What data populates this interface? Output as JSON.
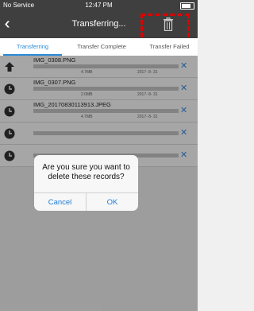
{
  "status_bar": {
    "carrier": "No Service",
    "wifi_icon": "wifi-icon",
    "time": "12:47 PM",
    "battery_icon": "battery-icon"
  },
  "nav": {
    "back_icon": "double-chevron-left-icon",
    "title": "Transferring...",
    "delete_icon": "trash-icon"
  },
  "tabs": [
    {
      "label": "Transferring",
      "active": true
    },
    {
      "label": "Transfer Complete",
      "active": false
    },
    {
      "label": "Transfer Failed",
      "active": false
    }
  ],
  "items": [
    {
      "name": "IMG_0308.PNG",
      "size": "4.7MB",
      "date": "2017- 8- 31",
      "status_icon": "upload-arrow-icon",
      "progress": 0.0
    },
    {
      "name": "IMG_0307.PNG",
      "size": "2.0MB",
      "date": "2017- 8- 31",
      "status_icon": "clock-icon",
      "progress": 0.0
    },
    {
      "name": "IMG_20170830113913.JPEG",
      "size": "4.7MB",
      "date": "2017- 8- 31",
      "status_icon": "clock-icon",
      "progress": 0.0
    },
    {
      "name": "",
      "size": "",
      "date": "",
      "status_icon": "clock-icon",
      "progress": 0.0
    },
    {
      "name": "",
      "size": "",
      "date": "",
      "status_icon": "clock-icon",
      "progress": 0.0
    }
  ],
  "dialog": {
    "message_line1": "Are you sure you want to",
    "message_line2": "delete these records?",
    "cancel_label": "Cancel",
    "ok_label": "OK"
  },
  "colors": {
    "accent": "#2a8ad6",
    "navbar": "#3f3f3f",
    "highlight": "#e00000"
  }
}
